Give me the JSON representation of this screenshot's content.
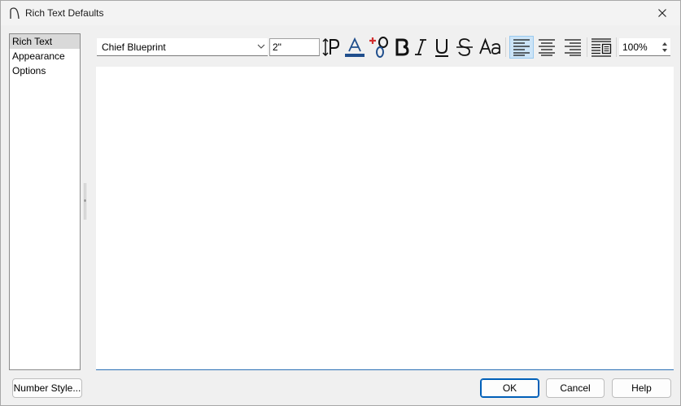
{
  "window": {
    "title": "Rich Text Defaults"
  },
  "nav": {
    "items": [
      "Rich Text",
      "Appearance",
      "Options"
    ],
    "selected_index": 0
  },
  "toolbar": {
    "font_name": "Chief Blueprint",
    "font_size": "2\"",
    "zoom": "100%",
    "icons": [
      "line-spacing-icon",
      "text-color-icon",
      "superscript-icon",
      "bold-icon",
      "italic-icon",
      "underline-icon",
      "strikethrough-icon",
      "change-case-icon",
      "align-left-icon",
      "align-center-icon",
      "align-right-icon",
      "paragraph-settings-icon"
    ],
    "active_alignment": "left"
  },
  "buttons": {
    "number_style": "Number Style...",
    "ok": "OK",
    "cancel": "Cancel",
    "help": "Help"
  },
  "colors": {
    "text_color_underline": "#1f4e8c",
    "superscript_plus": "#d32f2f",
    "active_tool_bg": "#cce4f7",
    "focus_border": "#2a6fb5",
    "default_button_border": "#005fb8"
  }
}
